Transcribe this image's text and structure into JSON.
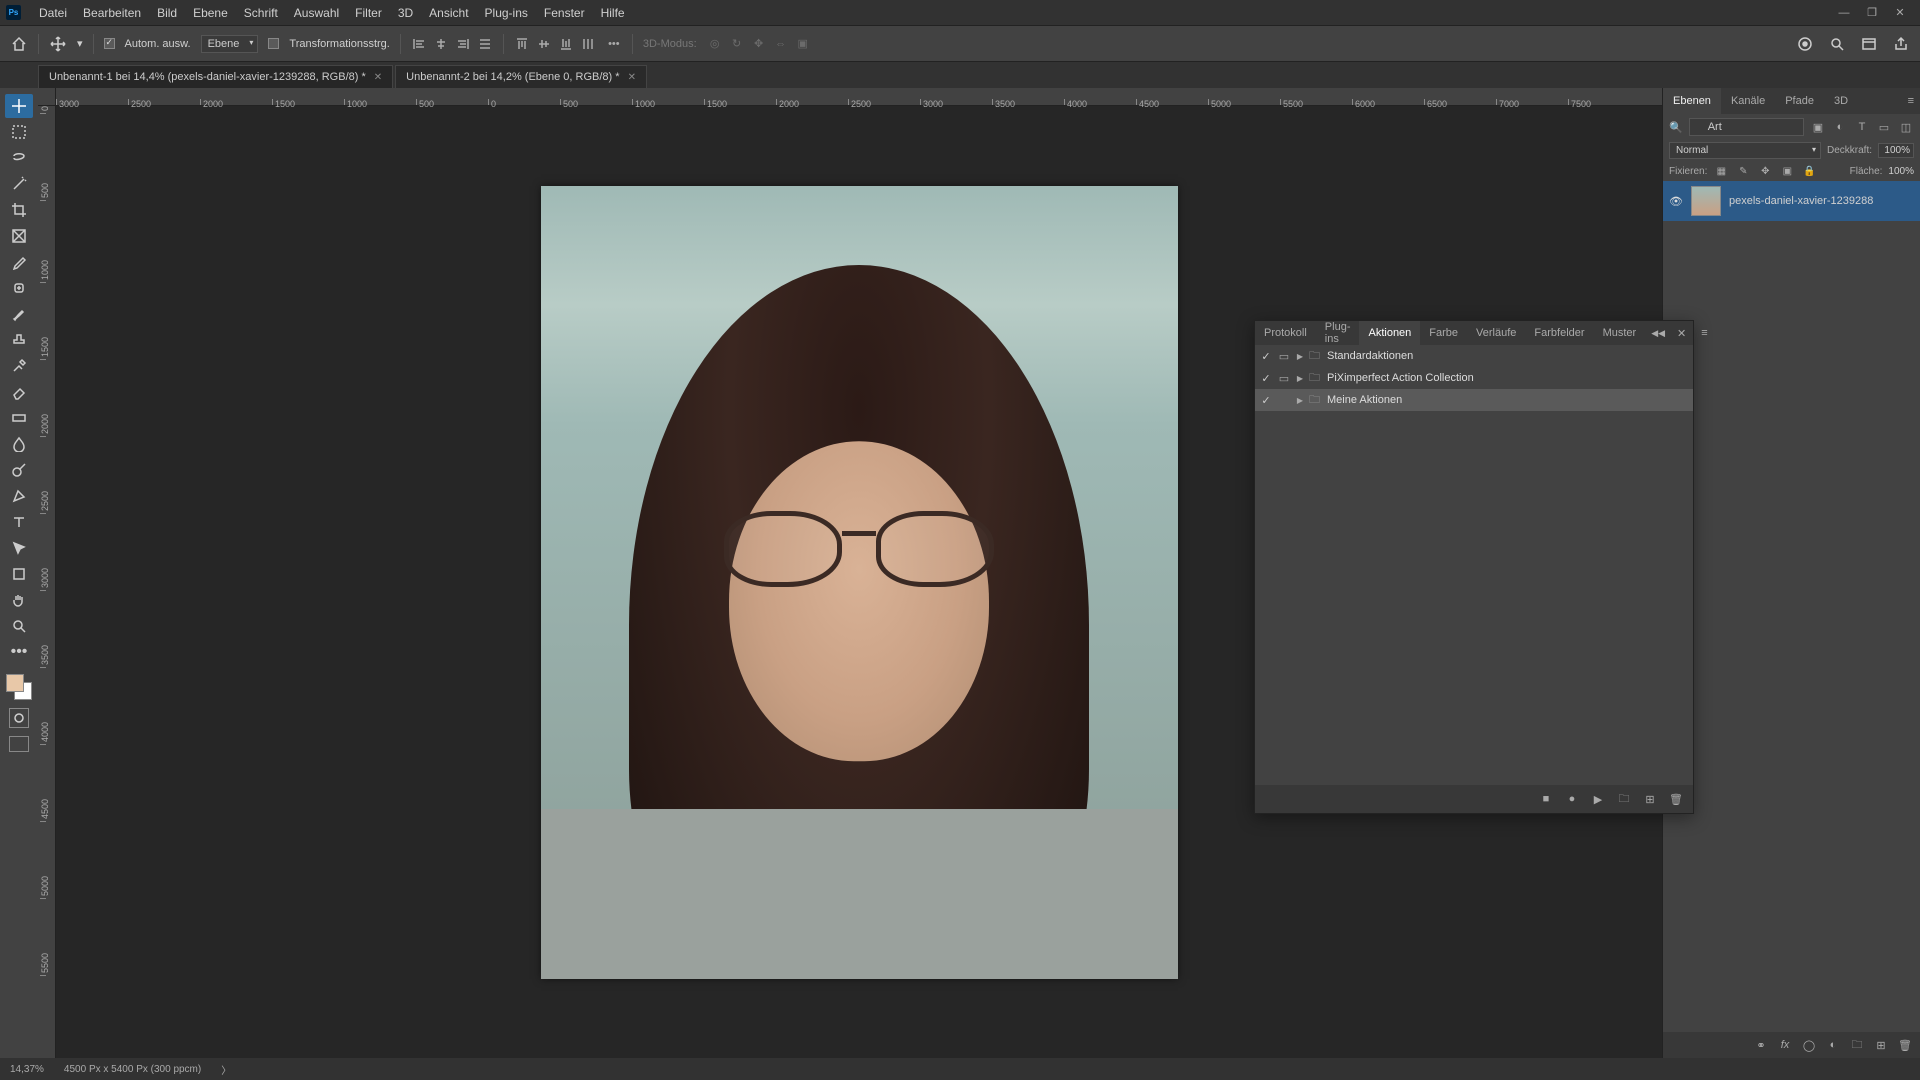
{
  "menubar": {
    "items": [
      "Datei",
      "Bearbeiten",
      "Bild",
      "Ebene",
      "Schrift",
      "Auswahl",
      "Filter",
      "3D",
      "Ansicht",
      "Plug-ins",
      "Fenster",
      "Hilfe"
    ]
  },
  "optbar": {
    "auto_select_label": "Autom. ausw.",
    "layer_dropdown": "Ebene",
    "transform_label": "Transformationsstrg.",
    "mode_label": "3D-Modus:"
  },
  "doctabs": [
    {
      "label": "Unbenannt-1 bei 14,4% (pexels-daniel-xavier-1239288, RGB/8) *",
      "active": true
    },
    {
      "label": "Unbenannt-2 bei 14,2% (Ebene 0, RGB/8) *",
      "active": false
    }
  ],
  "ruler_h": [
    "3000",
    "2500",
    "2000",
    "1500",
    "1000",
    "500",
    "0",
    "500",
    "1000",
    "1500",
    "2000",
    "2500",
    "3000",
    "3500",
    "4000",
    "4500",
    "5000",
    "5500",
    "6000",
    "6500",
    "7000",
    "7500"
  ],
  "ruler_v": [
    "0",
    "500",
    "1000",
    "1500",
    "2000",
    "2500",
    "3000",
    "3500",
    "4000",
    "4500",
    "5000",
    "5500"
  ],
  "layers_panel": {
    "tabs": [
      "Ebenen",
      "Kanäle",
      "Pfade",
      "3D"
    ],
    "search_kind": "Art",
    "blend_mode": "Normal",
    "opacity_label": "Deckkraft:",
    "opacity_value": "100%",
    "lock_label": "Fixieren:",
    "fill_label": "Fläche:",
    "fill_value": "100%",
    "layer_name": "pexels-daniel-xavier-1239288"
  },
  "float_panel": {
    "tabs": [
      "Protokoll",
      "Plug-ins",
      "Aktionen",
      "Farbe",
      "Verläufe",
      "Farbfelder",
      "Muster"
    ],
    "active_tab": "Aktionen",
    "items": [
      {
        "checked": true,
        "dlg": true,
        "name": "Standardaktionen",
        "selected": false
      },
      {
        "checked": true,
        "dlg": true,
        "name": "PiXimperfect Action Collection",
        "selected": false
      },
      {
        "checked": true,
        "dlg": false,
        "name": "Meine Aktionen",
        "selected": true
      }
    ]
  },
  "statusbar": {
    "zoom": "14,37%",
    "doc_info": "4500 Px x 5400 Px (300 ppcm)"
  }
}
